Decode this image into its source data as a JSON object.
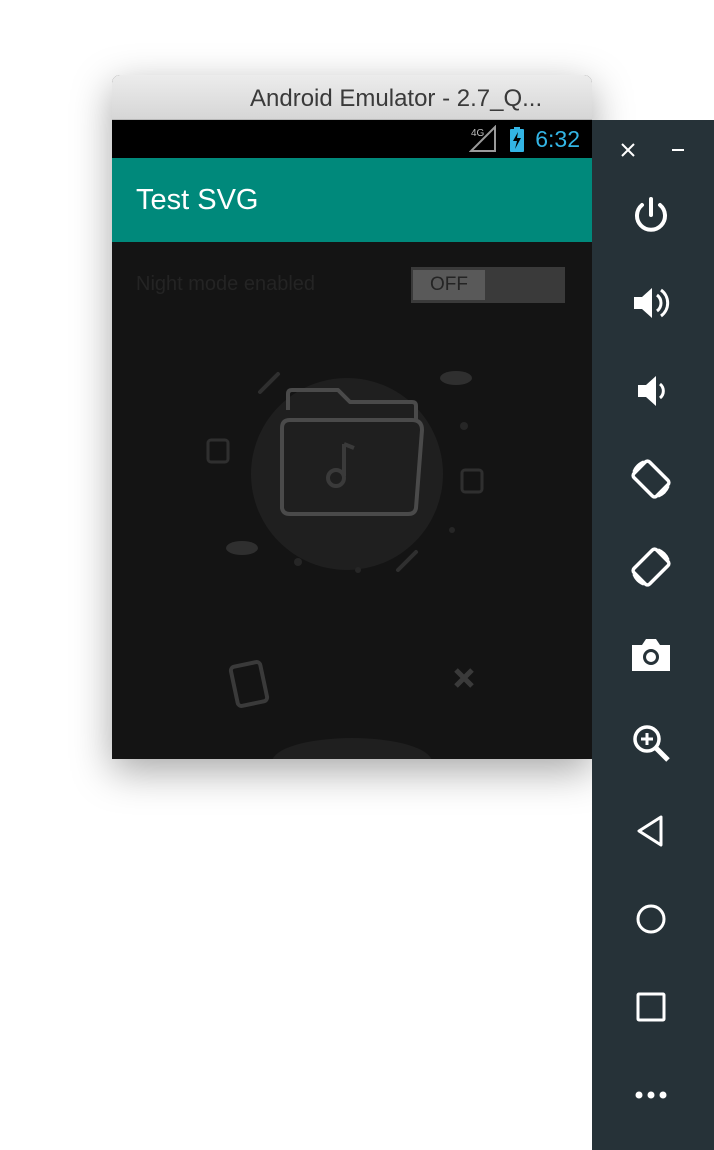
{
  "window": {
    "title": "Android Emulator - 2.7_Q..."
  },
  "status_bar": {
    "time": "6:32",
    "network": "4G",
    "icons": [
      "signal-4g-icon",
      "battery-charging-icon"
    ]
  },
  "app": {
    "title": "Test SVG",
    "night_mode": {
      "label": "Night mode enabled",
      "toggle_text": "OFF",
      "enabled": false
    }
  },
  "colors": {
    "app_bar": "#00897b",
    "toolbar": "#263238",
    "status_time": "#33b5e5"
  },
  "toolbar": {
    "window_controls": [
      "close-icon",
      "minimize-icon"
    ],
    "buttons": [
      "power-icon",
      "volume-up-icon",
      "volume-down-icon",
      "rotate-left-icon",
      "rotate-right-icon",
      "camera-icon",
      "zoom-icon",
      "back-icon",
      "home-icon",
      "overview-icon",
      "more-icon"
    ]
  }
}
